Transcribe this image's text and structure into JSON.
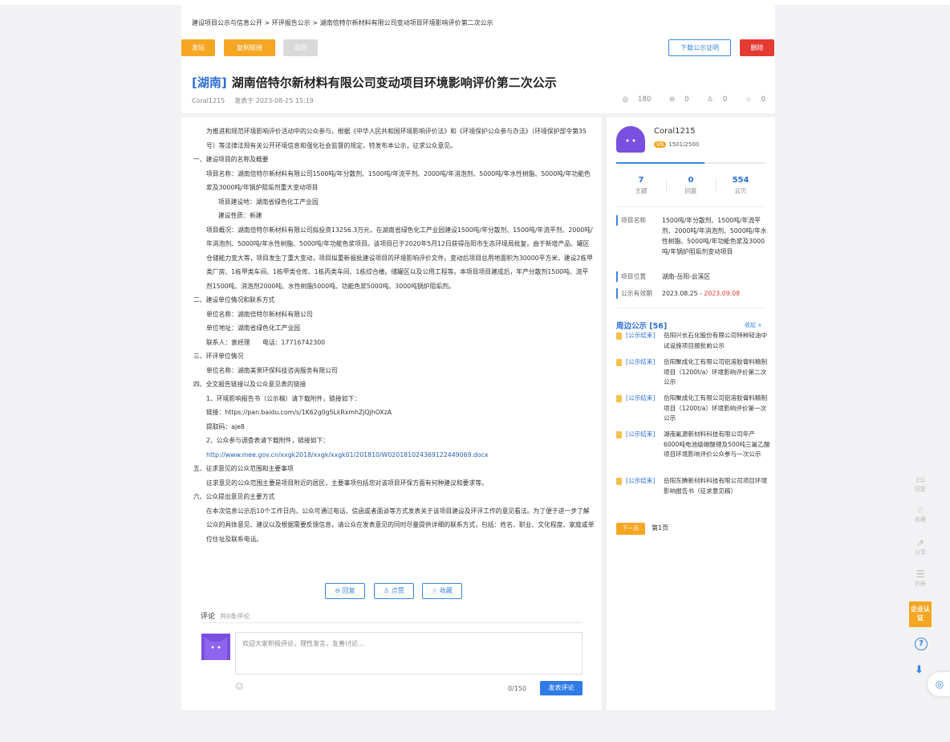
{
  "breadcrumb": "建设项目公示与信息公开 > 环评报告公示 > 湖南倍特尔新材料有限公司变动项目环境影响评价第二次公示",
  "toolbar": {
    "post": "发帖",
    "copy_link": "复制链接",
    "back": "返回",
    "download_cert": "下载公示证明",
    "delete": "删除"
  },
  "post": {
    "region": "[湖南]",
    "title": "湖南倍特尔新材料有限公司变动项目环境影响评价第二次公示",
    "author": "Coral1215",
    "date": "发表于 2023-08-25 15:19",
    "views": "180",
    "comments": "0",
    "likes": "0",
    "favorites": "0"
  },
  "article": [
    {
      "cls": "ind1",
      "text": "为推进和规范环境影响评价活动中的公众参与，根据《中华人民共和国环境影响评价法》和《环境保护公众参与办法》（环境保护部令第35号）等法律法规有关公开环境信息和强化社会监督的规定，特发布本公示，征求公众意见。"
    },
    {
      "cls": "",
      "text": "一、建设项目的名称及概要"
    },
    {
      "cls": "ind1",
      "text": "项目名称：湖南倍特尔新材料有限公司1500吨/年分散剂、1500吨/年流平剂、2000吨/年消泡剂、5000吨/年水性树脂、5000吨/年功能色浆及3000吨/年锅炉阻垢剂重大变动项目"
    },
    {
      "cls": "ind2",
      "text": "项目建设地：湖南省绿色化工产业园"
    },
    {
      "cls": "ind2",
      "text": "建设性质：新建"
    },
    {
      "cls": "ind1",
      "text": "项目概况：湖南倍特尔新材料有限公司拟投资13256.3万元，在湖南省绿色化工产业园建设1500吨/年分散剂、1500吨/年流平剂、2000吨/年消泡剂、5000吨/年水性树脂、5000吨/年功能色浆项目。该项目已于2020年5月12日获得岳阳市生态环境局批复。由于新增产品、罐区仓储能力变大等，项目发生了重大变动，项目拟重新报批建设项目的环境影响评价文件。变动后项目总用地面积为30000平方米，建设2栋甲类厂房、1栋甲类车间、1栋甲类仓库、1栋丙类车间、1栋综合楼。储罐区以及公用工程等。本项目项目建成后，年产分散剂1500吨、流平剂1500吨、消泡剂2000吨、水性树脂5000吨、功能色浆5000吨、3000吨锅炉阻垢剂。"
    },
    {
      "cls": "",
      "text": " 二、建设单位情况和联系方式"
    },
    {
      "cls": "ind1",
      "text": "单位名称：湖南倍特尔新材料有限公司"
    },
    {
      "cls": "ind1",
      "text": "单位地址：湖南省绿色化工产业园"
    },
    {
      "cls": "ind1",
      "text": "联系人：袁经理　　电话：17716742300"
    },
    {
      "cls": "",
      "text": "三、环评单位情况"
    },
    {
      "cls": "ind1",
      "text": "单位名称：湖南美景环保科技咨询服务有限公司"
    },
    {
      "cls": "",
      "text": "四、全文报告链接以及公众意见表的链接"
    },
    {
      "cls": "ind1",
      "text": "1、环境影响报告书（公示稿）请下载附件，链接如下："
    },
    {
      "cls": "ind1",
      "text": "链接：https://pan.baidu.com/s/1K62g0g5LkRxmhZjQjhOXzA"
    },
    {
      "cls": "ind1",
      "text": " 提取码：aje8"
    },
    {
      "cls": "ind1",
      "text": "2、公众参与调查表请下载附件，链接如下："
    },
    {
      "cls": "ind1 link",
      "text": "http://www.mee.gov.cn/xxgk2018/xxgk/xxgk01/201810/W020181024369122449069.docx"
    },
    {
      "cls": "",
      "text": "五、征求意见的公众范围和主要事项"
    },
    {
      "cls": "ind1",
      "text": "征求意见的公众范围主要是项目附近的居民，主要事项包括您对该项目环保方面有何种建议和要求等。"
    },
    {
      "cls": "",
      "text": "六、公众提出意见的主要方式"
    },
    {
      "cls": "ind1",
      "text": "在本次信息公示后10个工作日内，公众可通过电话、信函或者面谈等方式发表关于该项目建设及环评工作的意见看法。为了便于进一步了解公众的具体意见、建议以及根据需要反馈信息，请公众在发表意见的同时尽量提供详细的联系方式，包括：姓名、职业、文化程度、家庭或单位住址及联系电话。"
    }
  ],
  "actions": {
    "reply": "回复",
    "like": "点赞",
    "favorite": "收藏"
  },
  "comment": {
    "title": "评论",
    "count": "共0条评论",
    "placeholder": "欢迎大家积极评论，理性发言，友善讨论...",
    "counter": "0/150",
    "submit": "发表评论"
  },
  "user": {
    "name": "Coral1215",
    "level_badge": "V6",
    "level_progress": "1501/2500",
    "stats": [
      {
        "num": "7",
        "label": "主题"
      },
      {
        "num": "0",
        "label": "回复"
      },
      {
        "num": "554",
        "label": "云贝"
      }
    ]
  },
  "info": {
    "project_name_label": "项目名称",
    "project_name": "1500吨/年分散剂、1500吨/年流平剂、2000吨/年消泡剂、5000吨/年水性树脂、5000吨/年功能色浆及3000吨/年锅炉阻垢剂变动项目",
    "location_label": "项目位置",
    "location": "湖南-岳阳-云溪区",
    "period_label": "公示有效期",
    "period_start": "2023.08.25 - ",
    "period_end": "2023.09.08"
  },
  "nearby": {
    "title": "周边公示 [56]",
    "collapse": "收起 ∧",
    "items": [
      {
        "tag": "[公示结束]",
        "text": "岳阳兴长石化股份有限公司特种轻油中试设施项目报批前公示"
      },
      {
        "tag": "[公示结束]",
        "text": "岳阳聚成化工有限公司铝溶胶膏料精制项目（1200t/a）环境影响评价第二次公示"
      },
      {
        "tag": "[公示结束]",
        "text": "岳阳聚成化工有限公司铝溶胶膏料精制项目（1200t/a）环境影响评价第一次公示"
      },
      {
        "tag": "[公示结束]",
        "text": "湖南氟源新材料科技有限公司年产6000吨电池级碳酸锂及500吨三氟乙酸项目环境影响评价公众参与一次公示"
      },
      {
        "tag": "[公示结束]",
        "text": "岳阳东腾新材料科技有限公司项目环境影响报告书（征求意见稿）"
      }
    ],
    "next": "下一页",
    "page": "第1页"
  },
  "float_tools": [
    {
      "glyph": "▭",
      "label": "回复"
    },
    {
      "glyph": "☆",
      "label": "收藏"
    },
    {
      "glyph": "⇗",
      "label": "分享"
    },
    {
      "glyph": "☰",
      "label": "列表"
    }
  ],
  "enterprise": "企业认证",
  "help_glyph": "?",
  "download_glyph": "⬇",
  "floater_glyph": "◎"
}
